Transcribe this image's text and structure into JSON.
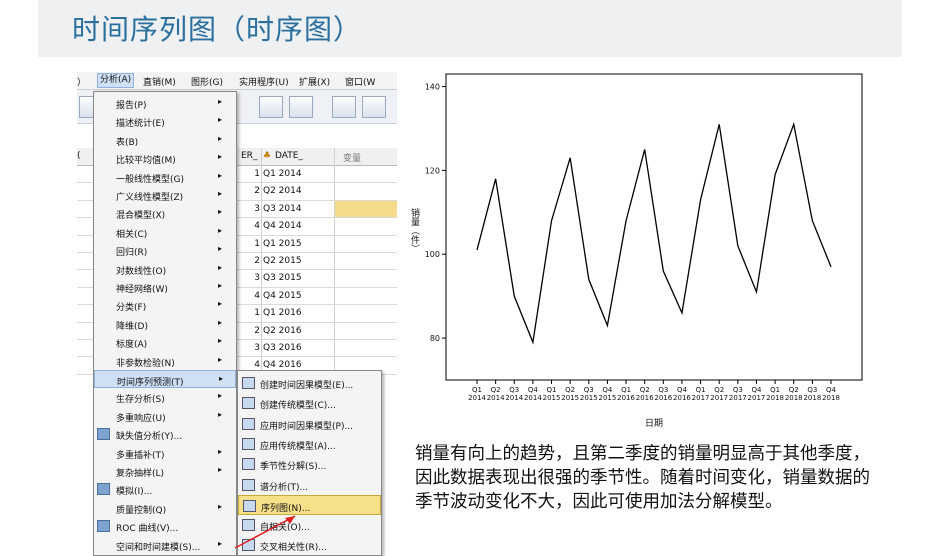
{
  "slide": {
    "title": "时间序列图（时序图）",
    "description": "销量有向上的趋势，且第二季度的销量明显高于其他季度，因此数据表现出很强的季节性。随着时间变化，销量数据的季节波动变化不大，因此可使用加法分解模型。"
  },
  "spss": {
    "menubar": [
      {
        "label": "）"
      },
      {
        "label": "分析(A)"
      },
      {
        "label": "直销(M)"
      },
      {
        "label": "图形(G)"
      },
      {
        "label": "实用程序(U)"
      },
      {
        "label": "扩展(X)"
      },
      {
        "label": "窗口(W"
      }
    ],
    "grid_headers": {
      "col1": "(",
      "col2": "ER_",
      "col3": "DATE_",
      "col4": "变量"
    },
    "rows": [
      {
        "num": "1",
        "date": "Q1 2014"
      },
      {
        "num": "2",
        "date": "Q2 2014"
      },
      {
        "num": "3",
        "date": "Q3 2014"
      },
      {
        "num": "4",
        "date": "Q4 2014"
      },
      {
        "num": "1",
        "date": "Q1 2015"
      },
      {
        "num": "2",
        "date": "Q2 2015"
      },
      {
        "num": "3",
        "date": "Q3 2015"
      },
      {
        "num": "4",
        "date": "Q4 2015"
      },
      {
        "num": "1",
        "date": "Q1 2016"
      },
      {
        "num": "2",
        "date": "Q2 2016"
      },
      {
        "num": "3",
        "date": "Q3 2016"
      },
      {
        "num": "4",
        "date": "Q4 2016"
      }
    ],
    "menu": [
      {
        "label": "报告(P)",
        "arrow": "▸"
      },
      {
        "label": "描述统计(E)",
        "arrow": "▸"
      },
      {
        "label": "表(B)",
        "arrow": "▸"
      },
      {
        "label": "比较平均值(M)",
        "arrow": "▸"
      },
      {
        "label": "一般线性模型(G)",
        "arrow": "▸"
      },
      {
        "label": "广义线性模型(Z)",
        "arrow": "▸"
      },
      {
        "label": "混合模型(X)",
        "arrow": "▸"
      },
      {
        "label": "相关(C)",
        "arrow": "▸"
      },
      {
        "label": "回归(R)",
        "arrow": "▸"
      },
      {
        "label": "对数线性(O)",
        "arrow": "▸"
      },
      {
        "label": "神经网络(W)",
        "arrow": "▸"
      },
      {
        "label": "分类(F)",
        "arrow": "▸"
      },
      {
        "label": "降维(D)",
        "arrow": "▸"
      },
      {
        "label": "标度(A)",
        "arrow": "▸"
      },
      {
        "label": "非参数检验(N)",
        "arrow": "▸"
      },
      {
        "label": "时间序列预测(T)",
        "arrow": "▸"
      },
      {
        "label": "生存分析(S)",
        "arrow": "▸"
      },
      {
        "label": "多重响应(U)",
        "arrow": "▸"
      },
      {
        "label": "缺失值分析(Y)...",
        "arrow": ""
      },
      {
        "label": "多重插补(T)",
        "arrow": "▸"
      },
      {
        "label": "复杂抽样(L)",
        "arrow": "▸"
      },
      {
        "label": "模拟(I)...",
        "arrow": ""
      },
      {
        "label": "质量控制(Q)",
        "arrow": "▸"
      },
      {
        "label": "ROC 曲线(V)...",
        "arrow": ""
      },
      {
        "label": "空间和时间建模(S)...",
        "arrow": "▸"
      }
    ],
    "submenu": [
      {
        "label": "创建时间因果模型(E)..."
      },
      {
        "label": "创建传统模型(C)..."
      },
      {
        "label": "应用时间因果模型(P)..."
      },
      {
        "label": "应用传统模型(A)..."
      },
      {
        "label": "季节性分解(S)..."
      },
      {
        "label": "谱分析(T)..."
      },
      {
        "label": "序列图(N)..."
      },
      {
        "label": "自相关(O)..."
      },
      {
        "label": "交叉相关性(R)..."
      }
    ]
  },
  "chart_data": {
    "type": "line",
    "xlabel": "日期",
    "ylabel": "销量（件）",
    "ylim": [
      70,
      143
    ],
    "yticks": [
      80,
      100,
      120,
      140
    ],
    "categories": [
      [
        "Q1",
        "2014"
      ],
      [
        "Q2",
        "2014"
      ],
      [
        "Q3",
        "2014"
      ],
      [
        "Q4",
        "2014"
      ],
      [
        "Q1",
        "2015"
      ],
      [
        "Q2",
        "2015"
      ],
      [
        "Q3",
        "2015"
      ],
      [
        "Q4",
        "2015"
      ],
      [
        "Q1",
        "2016"
      ],
      [
        "Q2",
        "2016"
      ],
      [
        "Q3",
        "2016"
      ],
      [
        "Q4",
        "2016"
      ],
      [
        "Q1",
        "2017"
      ],
      [
        "Q2",
        "2017"
      ],
      [
        "Q3",
        "2017"
      ],
      [
        "Q4",
        "2017"
      ],
      [
        "Q1",
        "2018"
      ],
      [
        "Q2",
        "2018"
      ],
      [
        "Q3",
        "2018"
      ],
      [
        "Q4",
        "2018"
      ]
    ],
    "values": [
      101,
      118,
      90,
      79,
      108,
      123,
      94,
      83,
      108,
      125,
      96,
      86,
      113,
      131,
      102,
      91,
      119,
      131,
      108,
      97
    ],
    "line_color": "#000000"
  }
}
